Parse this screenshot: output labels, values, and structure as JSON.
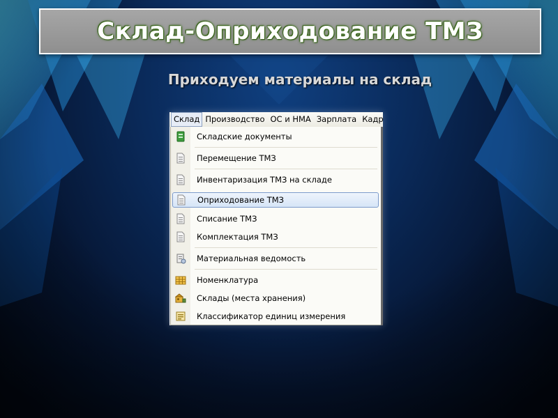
{
  "slide": {
    "title": "Склад-Оприходование ТМЗ",
    "subtitle": "Приходуем материалы на склад"
  },
  "menubar": {
    "items": [
      {
        "label": "Склад"
      },
      {
        "label": "Производство"
      },
      {
        "label": "ОС и НМА"
      },
      {
        "label": "Зарплата"
      },
      {
        "label": "Кадры"
      }
    ]
  },
  "menu": {
    "items": [
      {
        "label": "Складские документы",
        "icon": "folder-green-icon"
      },
      {
        "label": "Перемещение ТМЗ",
        "icon": "document-icon"
      },
      {
        "label": "Инвентаризация ТМЗ на складе",
        "icon": "document-icon"
      },
      {
        "label": "Оприходование ТМЗ",
        "icon": "document-icon",
        "selected": true
      },
      {
        "label": "Списание ТМЗ",
        "icon": "document-icon"
      },
      {
        "label": "Комплектация ТМЗ",
        "icon": "document-icon"
      },
      {
        "label": "Материальная ведомость",
        "icon": "report-icon"
      },
      {
        "label": "Номенклатура",
        "icon": "catalog-icon"
      },
      {
        "label": "Склады (места хранения)",
        "icon": "warehouse-icon"
      },
      {
        "label": "Классификатор единиц измерения",
        "icon": "classifier-icon"
      }
    ]
  },
  "colors": {
    "selection_border": "#7b9acb",
    "title_glow": "#3b6d18"
  }
}
